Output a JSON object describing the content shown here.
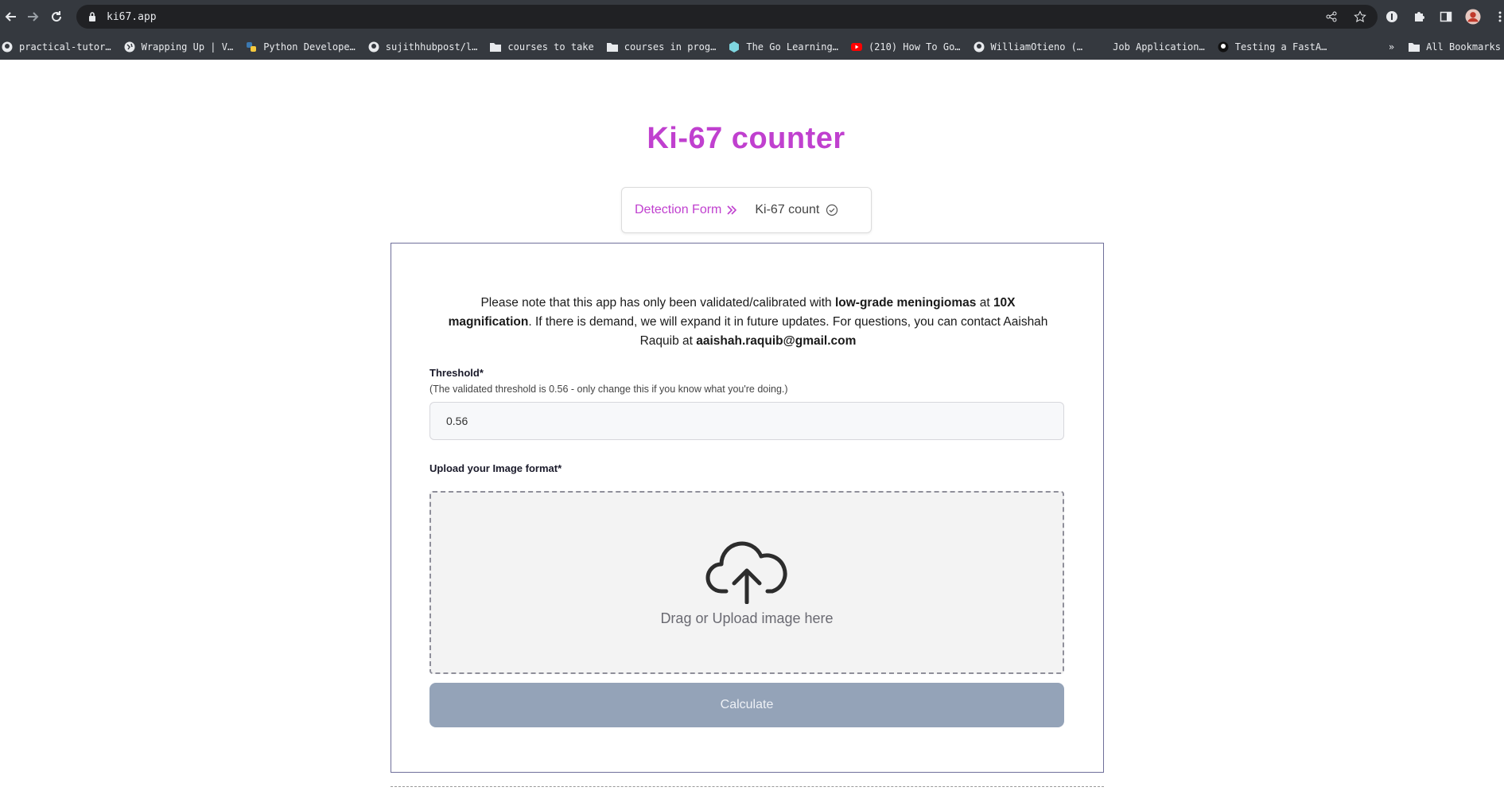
{
  "browser": {
    "url": "ki67.app",
    "bookmarks": [
      {
        "label": "practical-tutor…",
        "icon": "github-icon"
      },
      {
        "label": "Wrapping Up | V…",
        "icon": "globe-icon"
      },
      {
        "label": "Python Develope…",
        "icon": "python-icon"
      },
      {
        "label": "sujithhubpost/l…",
        "icon": "github-icon"
      },
      {
        "label": "courses to take",
        "icon": "folder-icon"
      },
      {
        "label": "courses in prog…",
        "icon": "folder-icon"
      },
      {
        "label": "The Go Learning…",
        "icon": "go-icon"
      },
      {
        "label": "(210) How To Go…",
        "icon": "youtube-icon"
      },
      {
        "label": "WilliamOtieno (…",
        "icon": "github-icon"
      },
      {
        "label": "Job Application…",
        "icon": ""
      },
      {
        "label": "Testing a FastA…",
        "icon": "site-icon"
      }
    ],
    "overflow": "»",
    "all_bookmarks": "All Bookmarks"
  },
  "page": {
    "title": "Ki-67 counter",
    "steps": {
      "active": "Detection Form",
      "next": "Ki-67 count"
    },
    "note": {
      "part1": "Please note that this app has only been validated/calibrated with ",
      "bold1": "low-grade meningiomas",
      "part2": " at ",
      "bold2": "10X magnification",
      "part3": ". If there is demand, we will expand it in future updates. For questions, you can contact Aaishah Raquib at ",
      "email": "aaishah.raquib@gmail.com"
    },
    "threshold": {
      "label": "Threshold*",
      "hint": "(The validated threshold is 0.56 - only change this if you know what you're doing.)",
      "value": "0.56"
    },
    "upload": {
      "label": "Upload your Image format*",
      "dropzone_text": "Drag or Upload image here"
    },
    "calculate_label": "Calculate"
  },
  "colors": {
    "accent": "#c040cf",
    "button_disabled": "#94a3b8",
    "chrome": "#35393f"
  }
}
